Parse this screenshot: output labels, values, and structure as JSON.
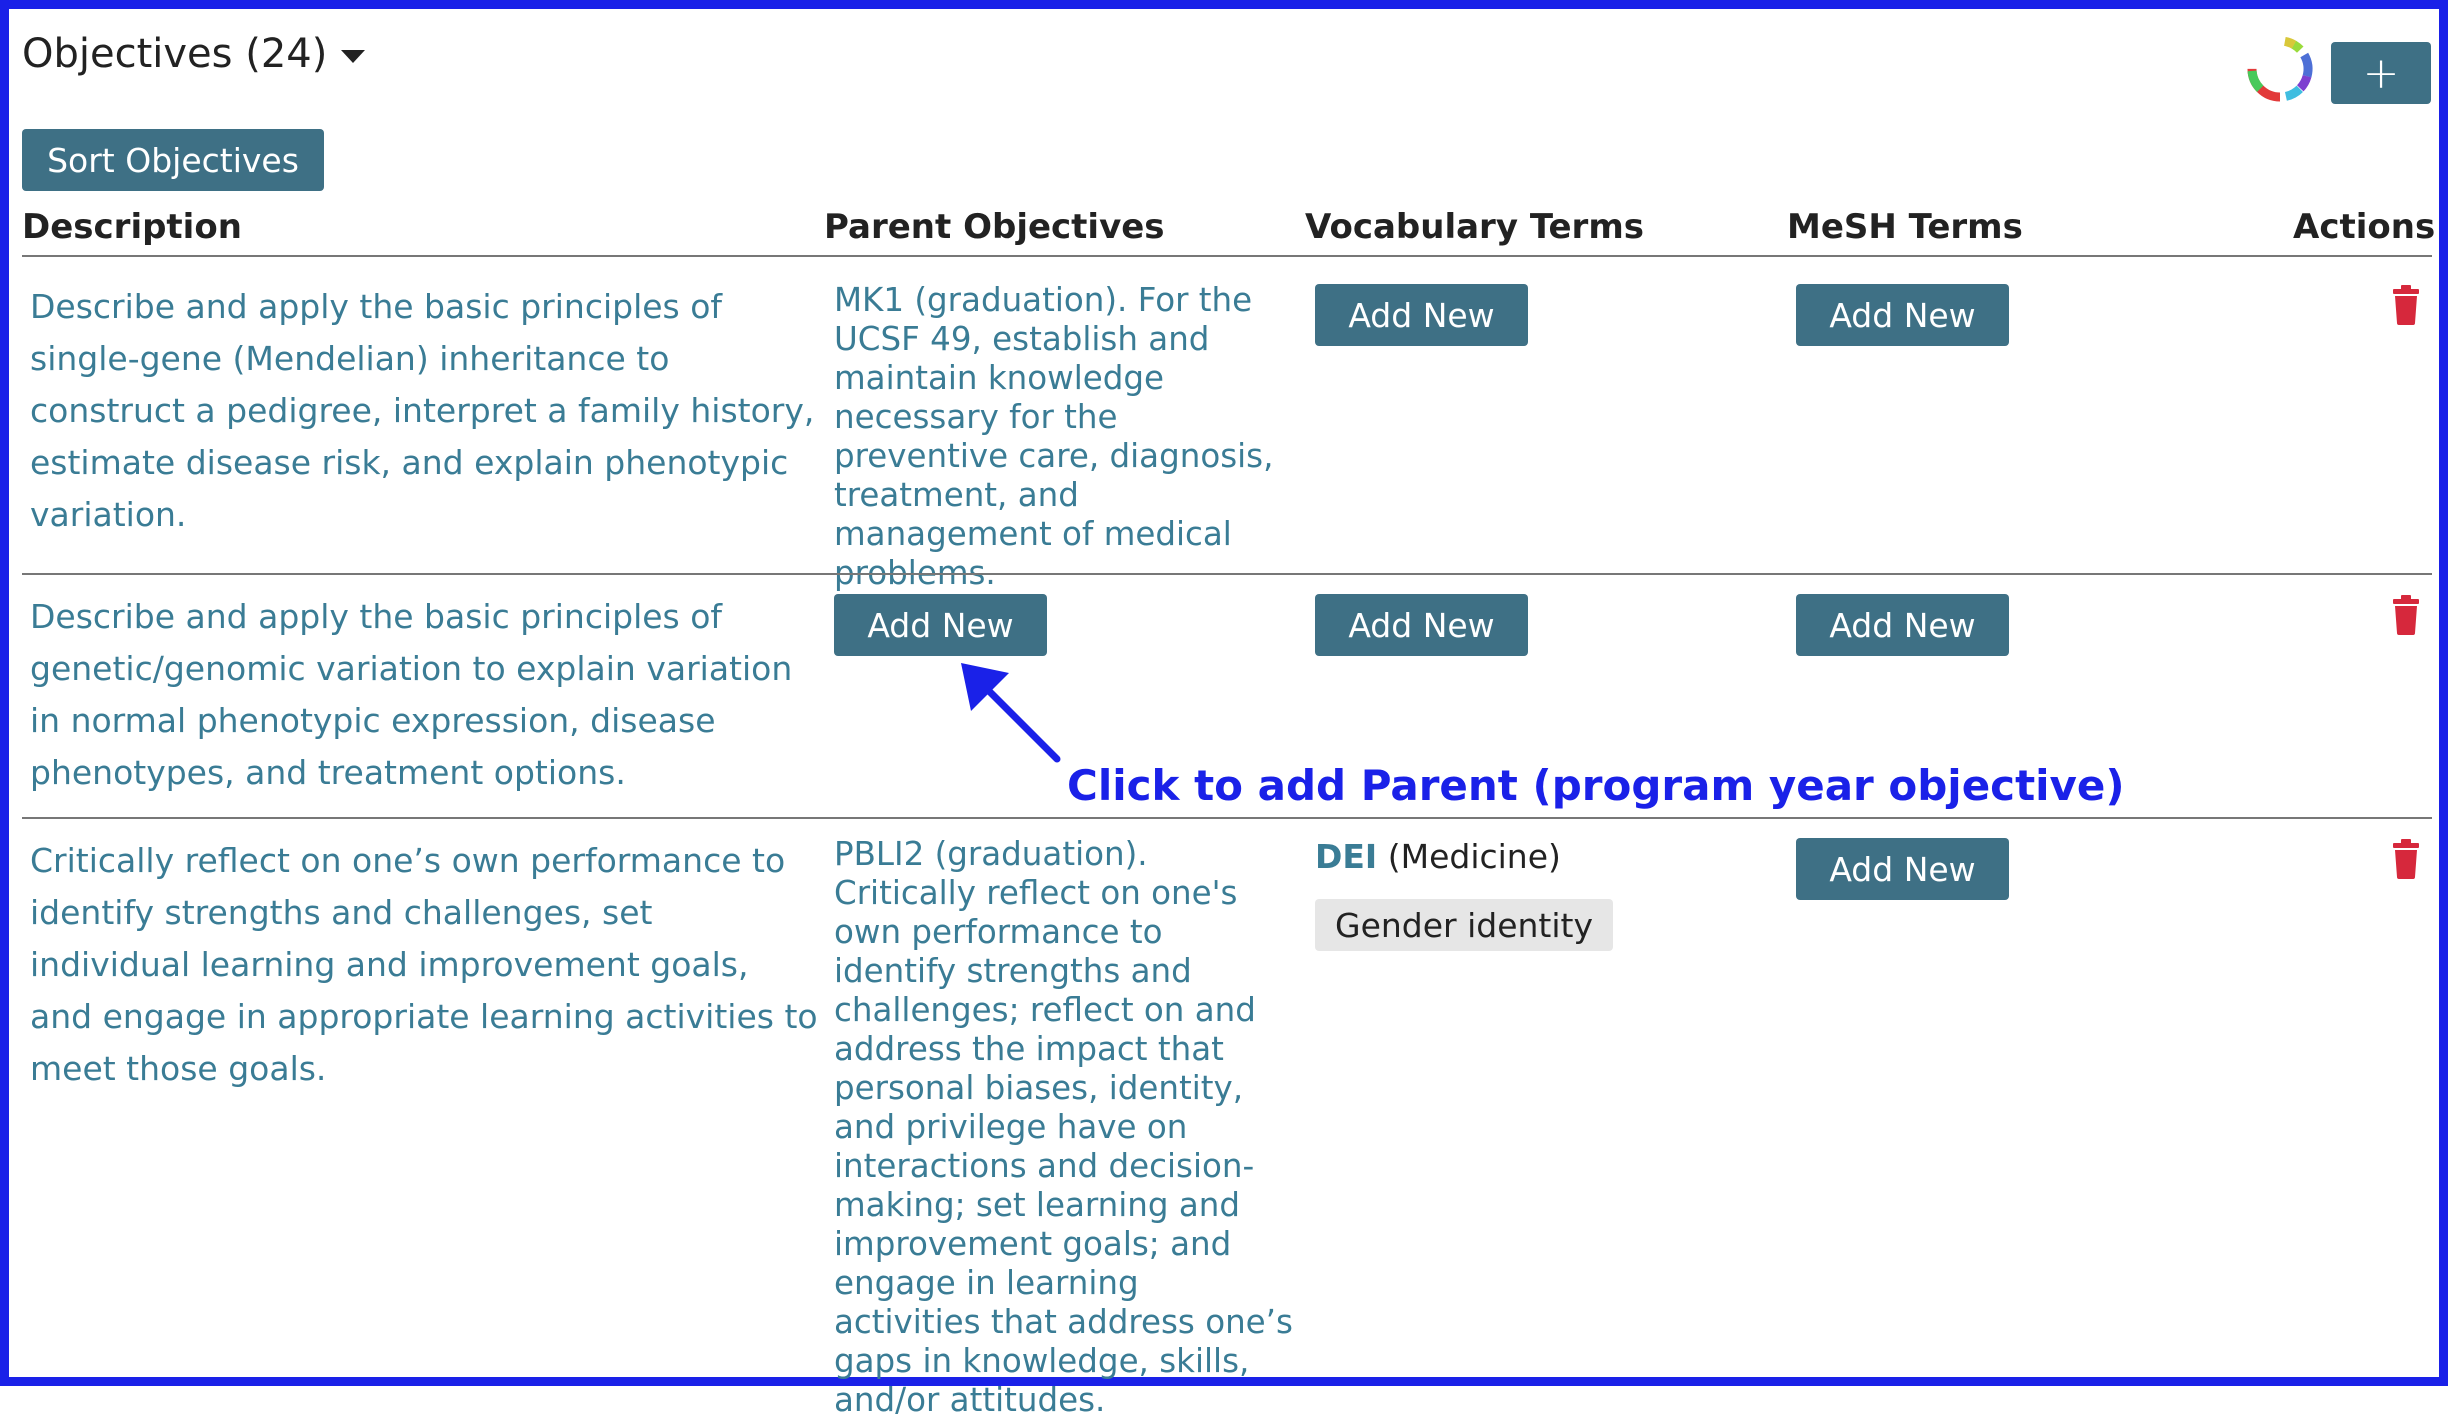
{
  "header": {
    "title": "Objectives (24)",
    "add_button_label": "+",
    "progress_icon": "donut-progress-icon",
    "dropdown_icon": "caret-down-icon"
  },
  "toolbar": {
    "sort_label": "Sort Objectives"
  },
  "table": {
    "columns": [
      "Description",
      "Parent Objectives",
      "Vocabulary Terms",
      "MeSH Terms",
      "Actions"
    ],
    "rows": [
      {
        "description": "Describe and apply the basic principles of single-gene (Mendelian) inheritance to construct a pedigree, interpret a family history, estimate disease risk, and explain phenotypic variation.",
        "parent": "MK1 (graduation). For the UCSF 49, establish and maintain knowledge necessary for the preventive care, diagnosis, treatment, and management of medical problems.",
        "vocabulary_action": "Add New",
        "mesh_action": "Add New",
        "delete_icon": "trash-icon"
      },
      {
        "description": "Describe and apply the basic principles of genetic/genomic variation to explain variation in normal phenotypic expression, disease phenotypes, and treatment options.",
        "parent_action": "Add New",
        "vocabulary_action": "Add New",
        "mesh_action": "Add New",
        "delete_icon": "trash-icon"
      },
      {
        "description": "Critically reflect on one’s own performance to identify strengths and challenges, set individual learning and improvement goals, and engage in appropriate learning activities to meet those goals.",
        "parent": "PBLI2 (graduation). Critically reflect on one's own performance to identify strengths and challenges; reflect on and address the impact that personal biases, identity, and privilege have on interactions and decision-making; set learning and improvement goals; and engage in learning activities that address one’s gaps in knowledge, skills, and/or attitudes.",
        "vocabulary": {
          "code": "DEI",
          "vocab": "(Medicine)",
          "term": "Gender identity"
        },
        "mesh_action": "Add New",
        "delete_icon": "trash-icon"
      }
    ]
  },
  "annotation": {
    "text": "Click to add Parent (program year objective)"
  },
  "colors": {
    "frame_border": "#1a21e8",
    "button_bg": "#3e7085",
    "link_text": "#3a7c95",
    "delete_red": "#d6283c",
    "annotation": "#1a21e8"
  }
}
